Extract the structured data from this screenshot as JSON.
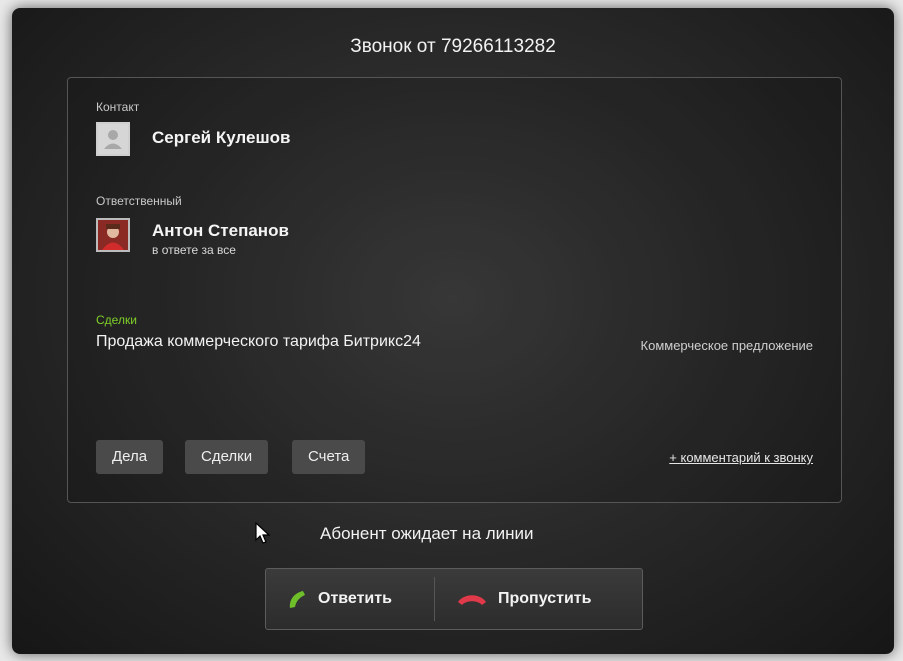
{
  "dialog": {
    "title": "Звонок от 79266113282",
    "status": "Абонент ожидает на линии"
  },
  "contact": {
    "label": "Контакт",
    "name": "Сергей Кулешов"
  },
  "responsible": {
    "label": "Ответственный",
    "name": "Антон Степанов",
    "subtitle": "в ответе за все"
  },
  "deals": {
    "label": "Сделки",
    "items": [
      {
        "name": "Продажа коммерческого тарифа Битрикс24",
        "stage": "Коммерческое предложение"
      }
    ]
  },
  "tabs": [
    "Дела",
    "Сделки",
    "Счета"
  ],
  "comment_link": "+ комментарий к звонку",
  "actions": {
    "answer": "Ответить",
    "skip": "Пропустить"
  },
  "colors": {
    "deals_label": "#7fd02a",
    "answer_icon": "#6fbf2a",
    "skip_icon": "#e0394a"
  },
  "icons": {
    "contact_avatar": "user-placeholder-icon",
    "answer": "phone-answer-icon",
    "skip": "phone-hangup-icon",
    "cursor": "mouse-cursor-icon"
  }
}
